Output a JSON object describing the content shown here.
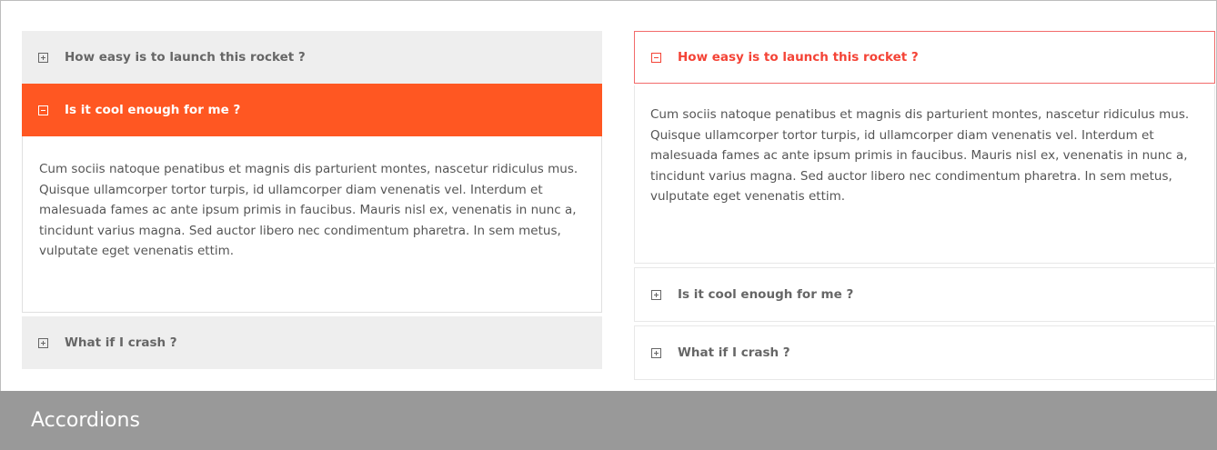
{
  "left_accordion": {
    "items": [
      {
        "title": "How easy is to launch this rocket ?",
        "expanded": false
      },
      {
        "title": "Is it cool enough for me ?",
        "expanded": true,
        "body": "Cum sociis natoque penatibus et magnis dis parturient montes, nascetur ridiculus mus. Quisque ullamcorper tortor turpis, id ullamcorper diam venenatis vel. Interdum et malesuada fames ac ante ipsum primis in faucibus. Mauris nisl ex, venenatis in nunc a, tincidunt varius magna. Sed auctor libero nec condimentum pharetra. In sem metus, vulputate eget venenatis ettim."
      },
      {
        "title": "What if I crash ?",
        "expanded": false
      }
    ],
    "colors": {
      "active_header": "#ff5722",
      "inactive_header": "#eeeeee"
    }
  },
  "right_accordion": {
    "items": [
      {
        "title": "How easy is to launch this rocket ?",
        "expanded": true,
        "body": "Cum sociis natoque penatibus et magnis dis parturient montes, nascetur ridiculus mus. Quisque ullamcorper tortor turpis, id ullamcorper diam venenatis vel. Interdum et malesuada fames ac ante ipsum primis in faucibus. Mauris nisl ex, venenatis in nunc a, tincidunt varius magna. Sed auctor libero nec condimentum pharetra. In sem metus, vulputate eget venenatis ettim."
      },
      {
        "title": "Is it cool enough for me ?",
        "expanded": false
      },
      {
        "title": "What if I crash ?",
        "expanded": false
      }
    ],
    "colors": {
      "active_header_text": "#f44336",
      "active_border": "#f26b6b"
    }
  },
  "caption": {
    "label": "Accordions",
    "background": "#999999"
  },
  "icons": {
    "expanded": "square-minus-icon",
    "collapsed": "square-plus-icon"
  }
}
